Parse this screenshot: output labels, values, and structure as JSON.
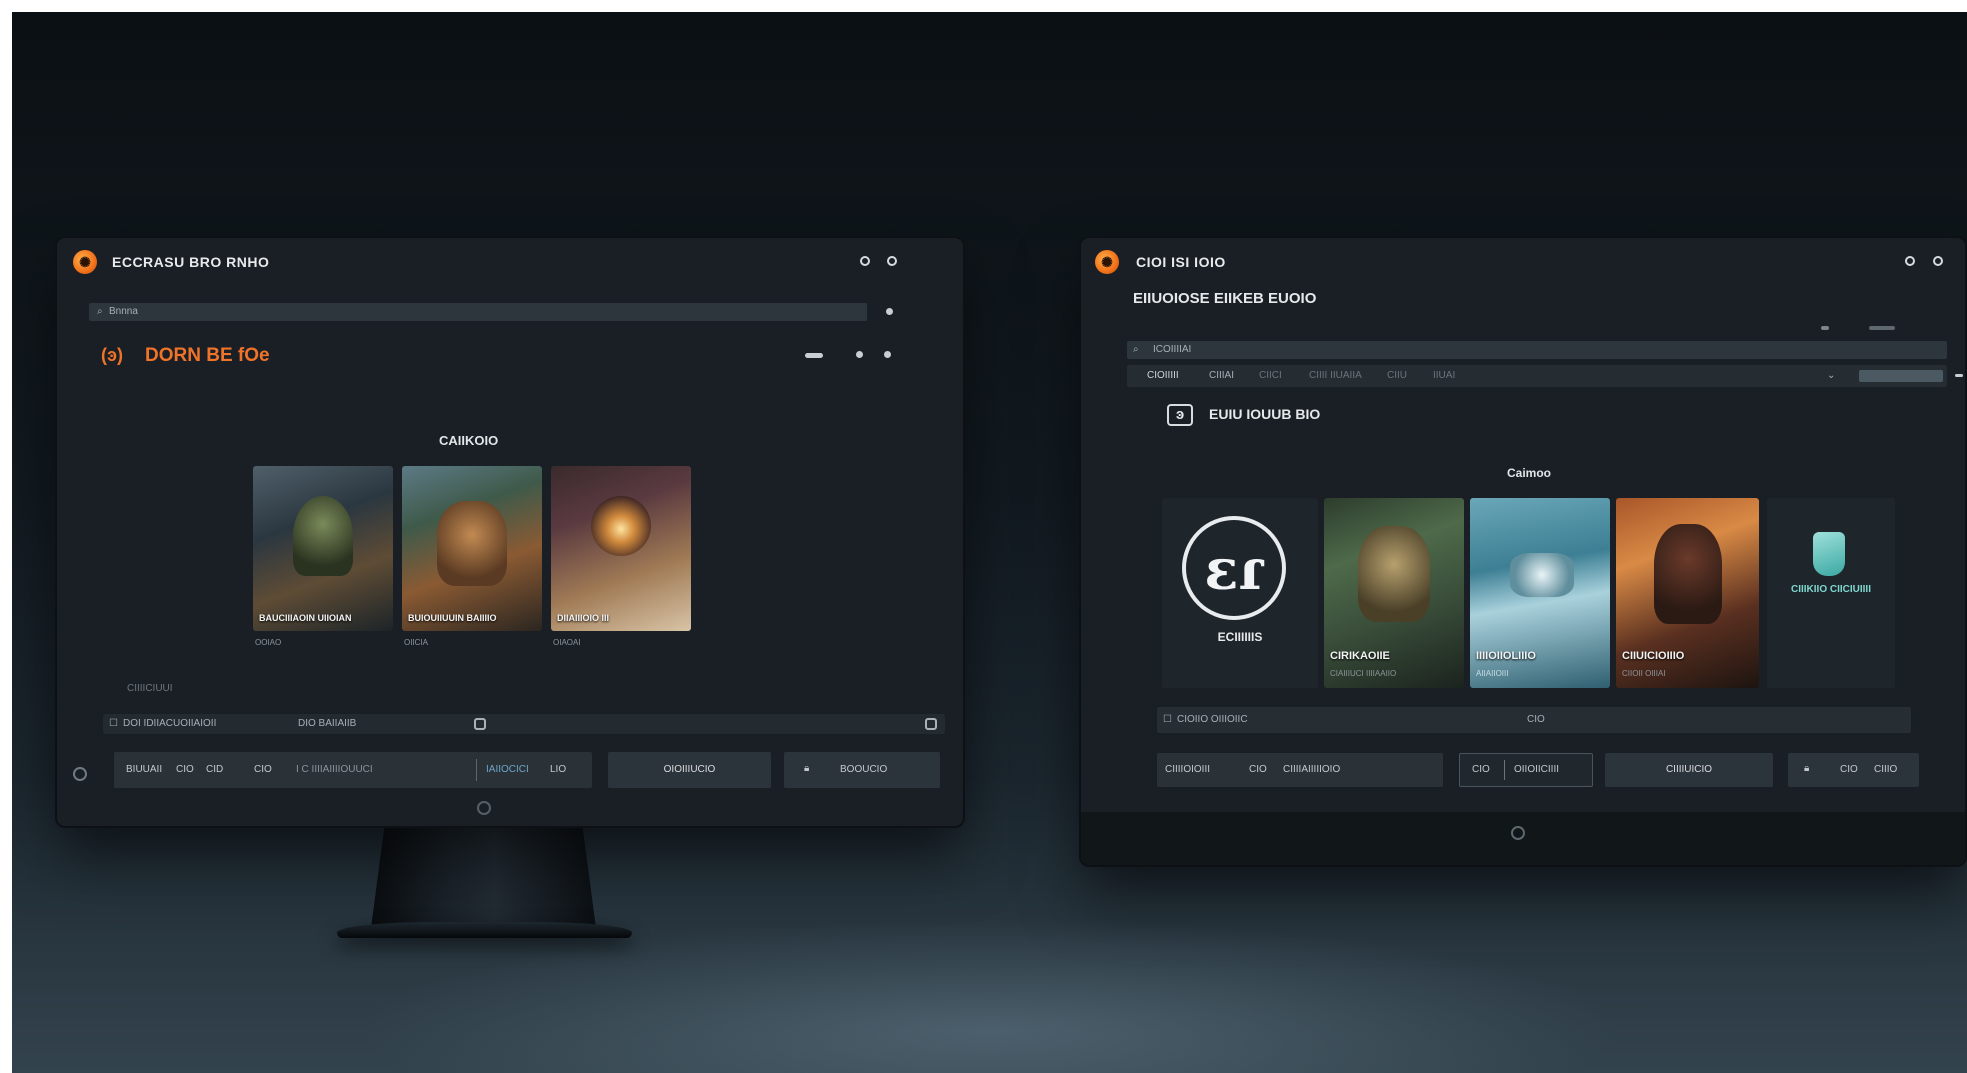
{
  "left_window": {
    "title": "ECCRASU BRO RNHO",
    "search_placeholder": "Bnnna",
    "heading": "DORN BE fOe",
    "section_title": "CAIIKOIO",
    "cards": [
      {
        "title": "BAUCIIIAOIN UIIOIAN",
        "caption": "OOIAO"
      },
      {
        "title": "BUIOUIIUUIN BAIIIIO",
        "caption": "OIICIA"
      },
      {
        "title": "DIIAIIIOIO III",
        "caption": "OIAOAI"
      }
    ],
    "link_text": "CIIIICIUUI",
    "filter_left": "DOI IDIIACUOIIAIOII",
    "filter_right": "DIO BAIIAIIB",
    "controls": {
      "label_a": "BIUUAII",
      "label_b": "CIO",
      "label_c": "CID",
      "label_d": "CIO",
      "label_e": "I C IIIIAIIIIOUUCI",
      "label_f": "IAIIOCICI",
      "label_g": "LIO",
      "primary_button": "OIOIIIUCIO",
      "secondary_button": "BOOUCIO"
    }
  },
  "right_window": {
    "title": "CIOI ISI IOIO",
    "subtitle": "EIIUOIOSE EIIKEB EUOIO",
    "search_placeholder": "ICOIIIIAI",
    "filters": [
      "CIOIIIII",
      "CIIIAI",
      "CIICI",
      "CIIII IIUAIIA",
      "CIIU",
      "IIUAI"
    ],
    "heading": "EUIU IOUUB BIO",
    "section_title": "Caimoo",
    "logo_left_mark": "ɛɾ",
    "logo_left_caption": "ECIIIIIIS",
    "cards": [
      {
        "title": "CIRIKAOIIE",
        "caption": "CIAIIIUCI IIIIAAIIO"
      },
      {
        "title": "IIIIOIIOLIIIO",
        "caption": "AIIAIIOIII"
      },
      {
        "title": "CIIUICIOIIIO",
        "caption": "CIIOII OIIIAI"
      }
    ],
    "logo_right_caption": "CIIIKIIO CIICIUIIII",
    "filter_left": "CIOIIO OIIIOIIC",
    "filter_right": "CIO",
    "controls": {
      "label_a": "CIIIIOIOIII",
      "label_b": "CIO",
      "label_c": "CIIIIAIIIIIOIO",
      "label_d": "CIO",
      "label_e": "OIIOIICIIII",
      "primary_button": "CIIIIUICIO",
      "label_f": "CIO",
      "label_g": "CIIIO"
    }
  }
}
